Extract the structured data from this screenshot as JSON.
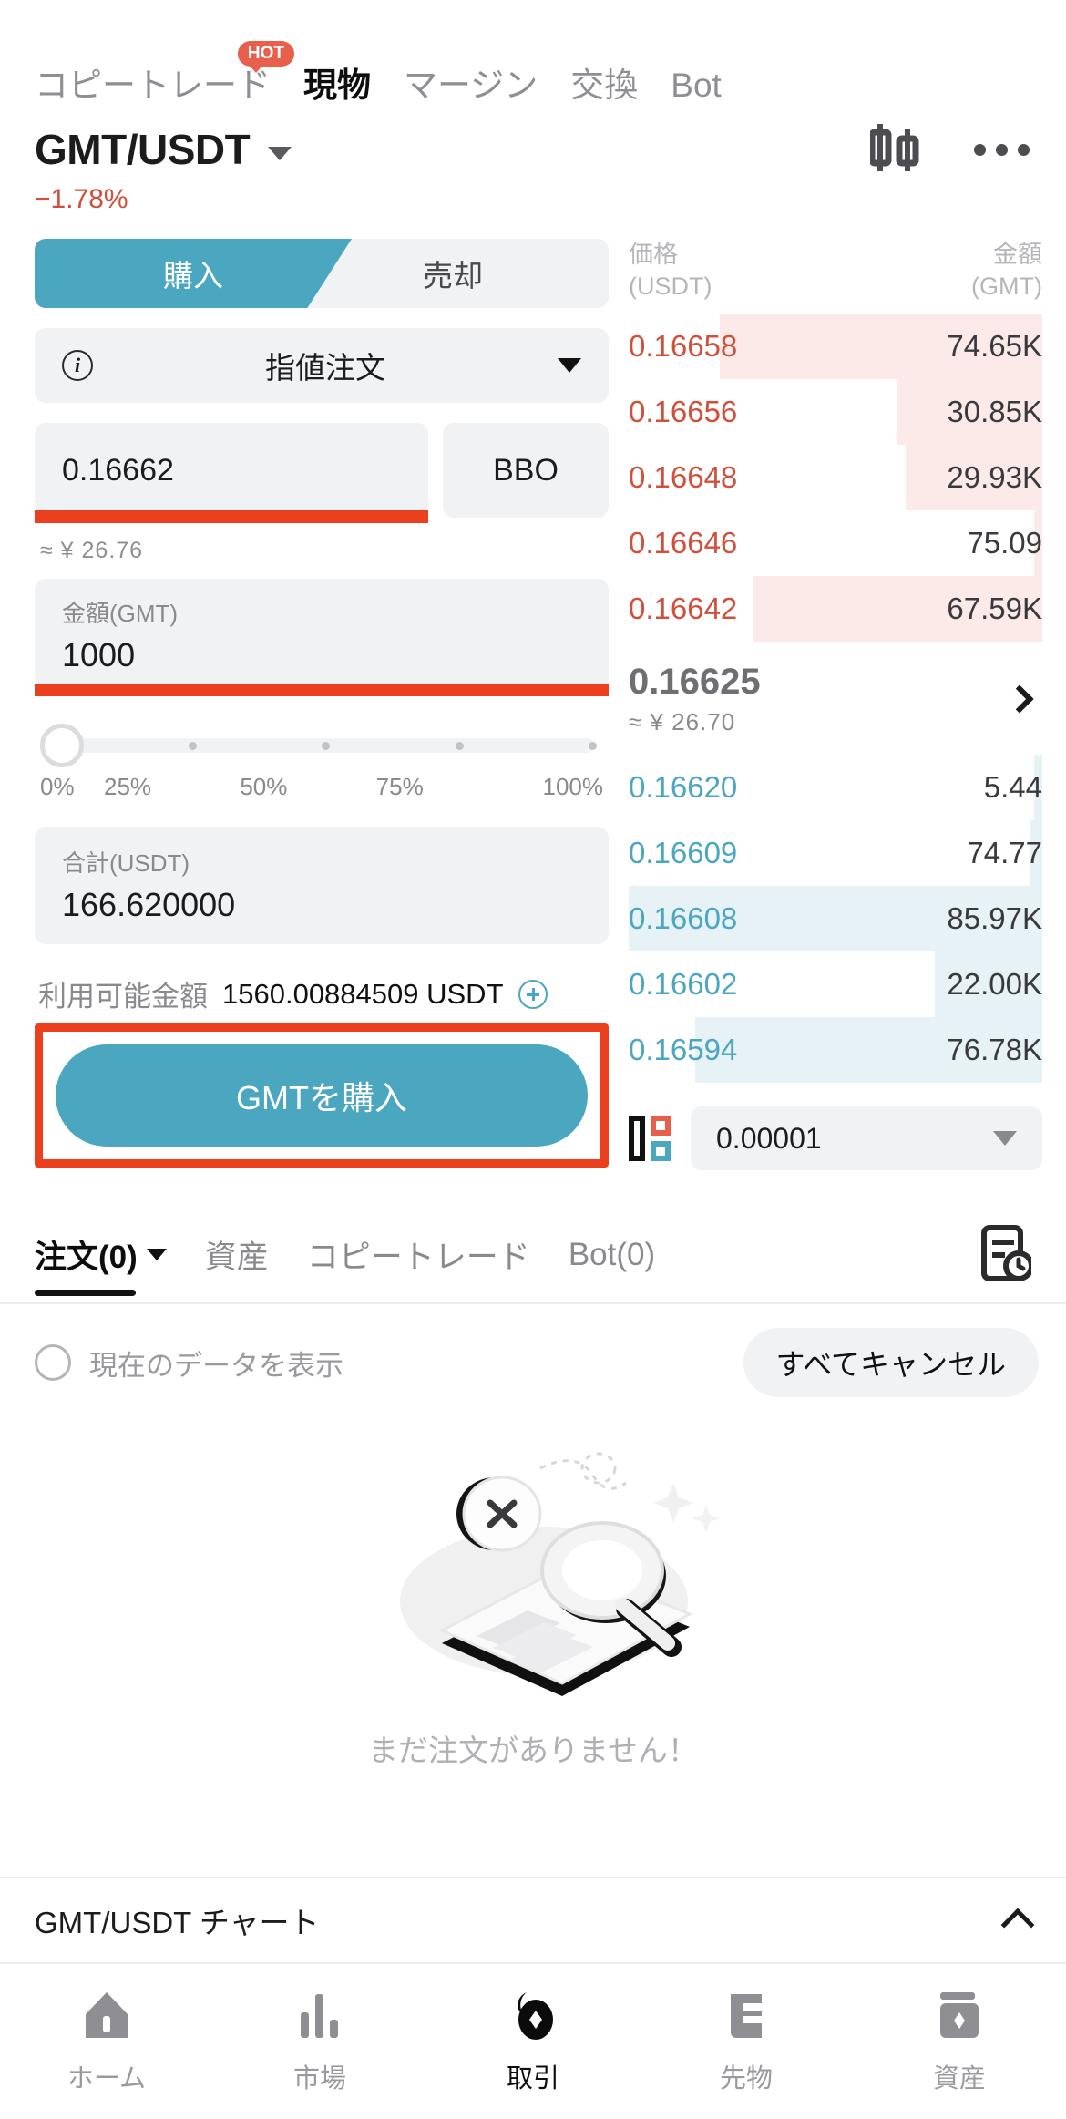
{
  "topnav": {
    "items": [
      {
        "label": "コピートレード",
        "badge": "HOT",
        "active": false
      },
      {
        "label": "現物",
        "active": true
      },
      {
        "label": "マージン",
        "active": false
      },
      {
        "label": "交換",
        "active": false
      },
      {
        "label": "Bot",
        "active": false
      }
    ]
  },
  "pair": {
    "name": "GMT/USDT",
    "change": "−1.78%",
    "change_color": "#d0503c"
  },
  "order_form": {
    "buy_label": "購入",
    "sell_label": "売却",
    "order_type": "指値注文",
    "price_value": "0.16662",
    "bbo_label": "BBO",
    "price_approx": "≈ ¥ 26.76",
    "amount_label": "金額(GMT)",
    "amount_value": "1000",
    "slider_ticks": [
      "0%",
      "25%",
      "50%",
      "75%",
      "100%"
    ],
    "slider_value": 0,
    "total_label": "合計(USDT)",
    "total_value": "166.620000",
    "available_label": "利用可能金額",
    "available_value": "1560.00884509 USDT",
    "submit_label": "GMTを購入",
    "accent_color": "#4ba6c0",
    "annotation_color": "#ec3f1e"
  },
  "orderbook": {
    "col_price": "価格",
    "col_price_unit": "(USDT)",
    "col_amount": "金額",
    "col_amount_unit": "(GMT)",
    "asks": [
      {
        "price": "0.16658",
        "amount": "74.65K",
        "depth": 78
      },
      {
        "price": "0.16656",
        "amount": "30.85K",
        "depth": 35
      },
      {
        "price": "0.16648",
        "amount": "29.93K",
        "depth": 33
      },
      {
        "price": "0.16646",
        "amount": "75.09",
        "depth": 2
      },
      {
        "price": "0.16642",
        "amount": "67.59K",
        "depth": 70
      }
    ],
    "mid_price": "0.16625",
    "mid_approx": "≈ ¥ 26.70",
    "bids": [
      {
        "price": "0.16620",
        "amount": "5.44",
        "depth": 2
      },
      {
        "price": "0.16609",
        "amount": "74.77",
        "depth": 3
      },
      {
        "price": "0.16608",
        "amount": "85.97K",
        "depth": 100
      },
      {
        "price": "0.16602",
        "amount": "22.00K",
        "depth": 26
      },
      {
        "price": "0.16594",
        "amount": "76.78K",
        "depth": 84
      }
    ],
    "tick_size": "0.00001",
    "ask_color": "#d0503c",
    "bid_color": "#4ba6c0"
  },
  "bottom_tabs": {
    "items": [
      {
        "label": "注文(0)",
        "active": true,
        "has_caret": true
      },
      {
        "label": "資産",
        "active": false
      },
      {
        "label": "コピートレード",
        "active": false
      },
      {
        "label": "Bot(0)",
        "active": false
      }
    ],
    "filter_label": "現在のデータを表示",
    "cancel_all_label": "すべてキャンセル"
  },
  "empty_state": {
    "text": "まだ注文がありません！"
  },
  "chart_bar": {
    "label": "GMT/USDT  チャート"
  },
  "bottom_nav": {
    "items": [
      {
        "label": "ホーム",
        "icon": "home-icon",
        "active": false
      },
      {
        "label": "市場",
        "icon": "market-bars-icon",
        "active": false
      },
      {
        "label": "取引",
        "icon": "trade-icon",
        "active": true
      },
      {
        "label": "先物",
        "icon": "futures-icon",
        "active": false
      },
      {
        "label": "資産",
        "icon": "assets-icon",
        "active": false
      }
    ]
  }
}
